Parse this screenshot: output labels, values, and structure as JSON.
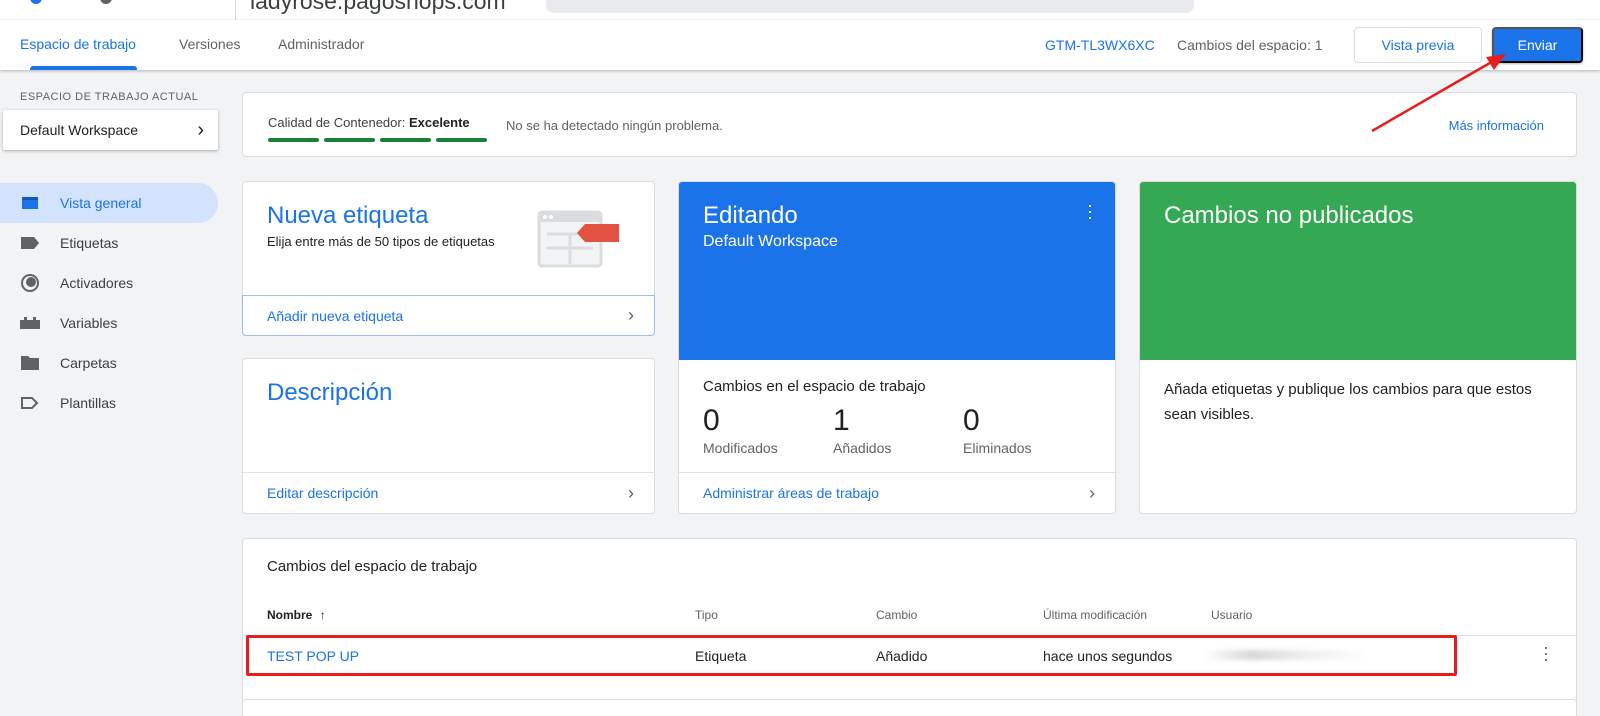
{
  "browser": {
    "url": "ladyrose.pagoshops.com"
  },
  "toolbar": {
    "tabs": [
      {
        "label": "Espacio de trabajo"
      },
      {
        "label": "Versiones"
      },
      {
        "label": "Administrador"
      }
    ],
    "container_id": "GTM-TL3WX6XC",
    "workspace_changes": "Cambios del espacio: 1",
    "preview_label": "Vista previa",
    "submit_label": "Enviar"
  },
  "sidebar": {
    "workspace_label": "ESPACIO DE TRABAJO ACTUAL",
    "workspace_name": "Default Workspace",
    "items": [
      {
        "label": "Vista general",
        "icon": "overview-icon"
      },
      {
        "label": "Etiquetas",
        "icon": "tag-icon"
      },
      {
        "label": "Activadores",
        "icon": "trigger-icon"
      },
      {
        "label": "Variables",
        "icon": "variables-icon"
      },
      {
        "label": "Carpetas",
        "icon": "folder-icon"
      },
      {
        "label": "Plantillas",
        "icon": "template-icon"
      }
    ]
  },
  "quality": {
    "label": "Calidad de Contenedor:",
    "value": "Excelente",
    "segments_filled": 4,
    "message": "No se ha detectado ningún problema.",
    "more_link": "Más información"
  },
  "new_tag": {
    "title": "Nueva etiqueta",
    "subtitle": "Elija entre más de 50 tipos de etiquetas",
    "link": "Añadir nueva etiqueta"
  },
  "description": {
    "title": "Descripción",
    "link": "Editar descripción"
  },
  "editing": {
    "title": "Editando",
    "workspace": "Default Workspace",
    "section": "Cambios en el espacio de trabajo",
    "stats": [
      {
        "value": "0",
        "label": "Modificados"
      },
      {
        "value": "1",
        "label": "Añadidos"
      },
      {
        "value": "0",
        "label": "Eliminados"
      }
    ],
    "link": "Administrar áreas de trabajo"
  },
  "unpublished": {
    "title": "Cambios no publicados",
    "body": "Añada etiquetas y publique los cambios para que estos sean visibles."
  },
  "changes_table": {
    "title": "Cambios del espacio de trabajo",
    "columns": [
      "Nombre",
      "Tipo",
      "Cambio",
      "Última modificación",
      "Usuario"
    ],
    "rows": [
      {
        "name": "TEST POP UP",
        "type": "Etiqueta",
        "change": "Añadido",
        "modified": "hace unos segundos",
        "user": ""
      }
    ]
  },
  "colors": {
    "accent": "#1a73e8",
    "editing_header": "#1a73e8",
    "unpublished_header": "#34a853",
    "quality_bar": "#188038",
    "annotation": "#e81c1c"
  }
}
